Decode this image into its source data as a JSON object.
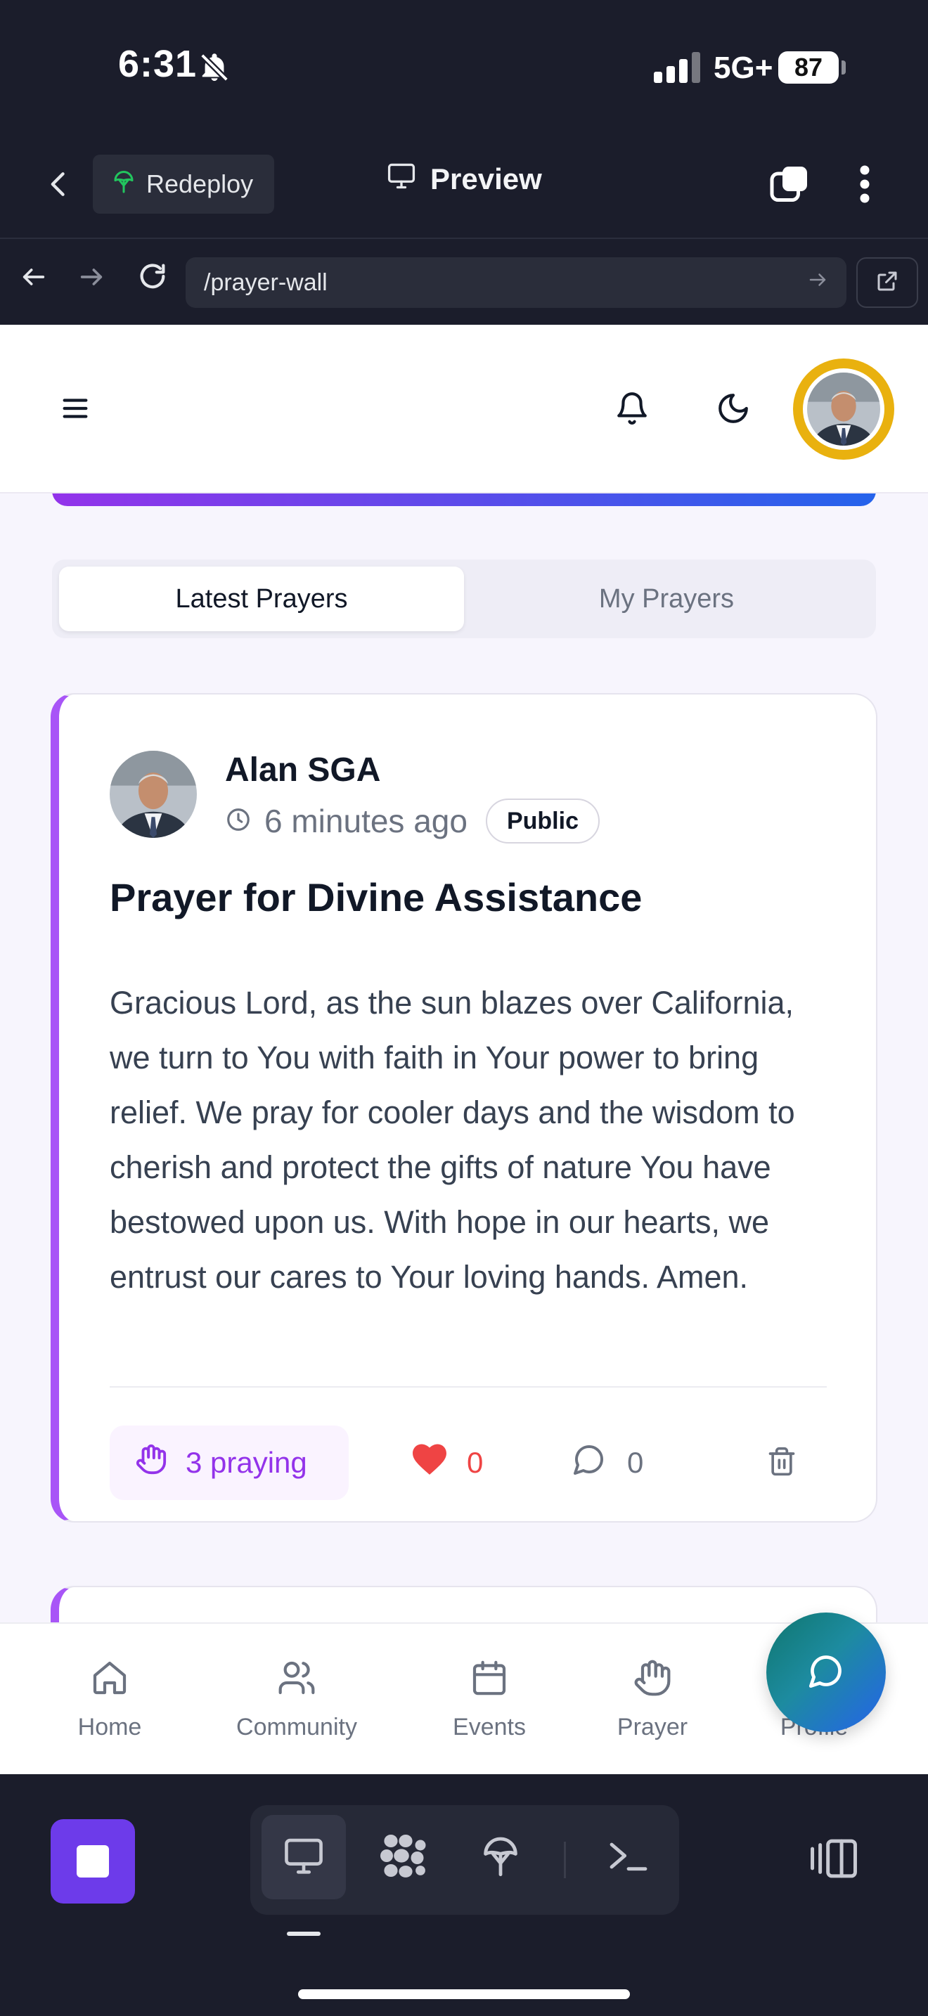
{
  "status_bar": {
    "time": "6:31",
    "network": "5G+",
    "battery": "87"
  },
  "replit": {
    "redeploy_label": "Redeploy",
    "preview_label": "Preview",
    "url": "/prayer-wall"
  },
  "tabs": {
    "latest": "Latest Prayers",
    "mine": "My Prayers"
  },
  "post": {
    "author": "Alan SGA",
    "time_ago": "6 minutes ago",
    "visibility": "Public",
    "title": "Prayer for Divine Assistance",
    "body": "Gracious Lord, as the sun blazes over California, we turn to You with faith in Your power to bring relief. We pray for cooler days and the wisdom to cherish and protect the gifts of nature You have bestowed upon us. With hope in our hearts, we entrust our cares to Your loving hands. Amen.",
    "praying_label": "3 praying",
    "likes": "0",
    "comments": "0"
  },
  "bottom_nav": {
    "home": "Home",
    "community": "Community",
    "events": "Events",
    "prayer": "Prayer",
    "profile": "Profile"
  },
  "colors": {
    "accent_purple": "#9333ea",
    "accent_blue": "#2563eb",
    "avatar_ring": "#e9b10f",
    "like_red": "#ef4444",
    "stop_button": "#6d3bea"
  }
}
